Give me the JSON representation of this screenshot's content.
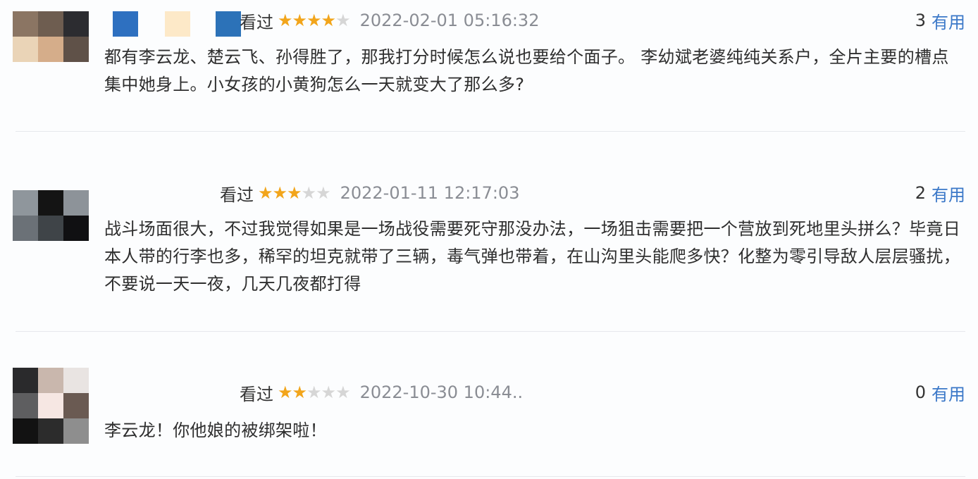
{
  "reviews": [
    {
      "watched_label": "看过",
      "rating": 4,
      "max_rating": 5,
      "time": "2022-02-01 05:16:32",
      "useful_count": "3",
      "useful_label": "有用",
      "content": "都有李云龙、楚云飞、孙得胜了，那我打分时候怎么说也要给个面子。 李幼斌老婆纯纯关系户，全片主要的槽点集中她身上。小女孩的小黄狗怎么一天就变大了那么多?",
      "avatar_colors": [
        "#8b7563",
        "#6e5d50",
        "#2c2c30",
        "#ead4b7",
        "#d5ad8a",
        "#5f5148"
      ],
      "mosaic_colors": [
        "#2e70c0",
        "#fde9c8",
        "#2c72b8"
      ]
    },
    {
      "watched_label": "看过",
      "rating": 3,
      "max_rating": 5,
      "time": "2022-01-11 12:17:03",
      "useful_count": "2",
      "useful_label": "有用",
      "content": "战斗场面很大，不过我觉得如果是一场战役需要死守那没办法，一场狙击需要把一个营放到死地里头拼么？毕竟日本人带的行李也多，稀罕的坦克就带了三辆，毒气弹也带着，在山沟里头能爬多快？化整为零引导敌人层层骚扰，不要说一天一夜，几天几夜都打得",
      "avatar_colors": [
        "#8f969c",
        "#141414",
        "#8d9399",
        "#6b7177",
        "#3f4448",
        "#101012"
      ]
    },
    {
      "watched_label": "看过",
      "rating": 2,
      "max_rating": 5,
      "time": "2022-10-30 10:44..",
      "useful_count": "0",
      "useful_label": "有用",
      "content": "李云龙！你他娘的被绑架啦！",
      "avatar_colors": [
        "#2a2a2c",
        "#c9b7ad",
        "#e9e4e2",
        "#5e5e60",
        "#f6e7e3",
        "#6a5a52",
        "#121212",
        "#2c2c2c",
        "#8e8e8e"
      ]
    }
  ]
}
